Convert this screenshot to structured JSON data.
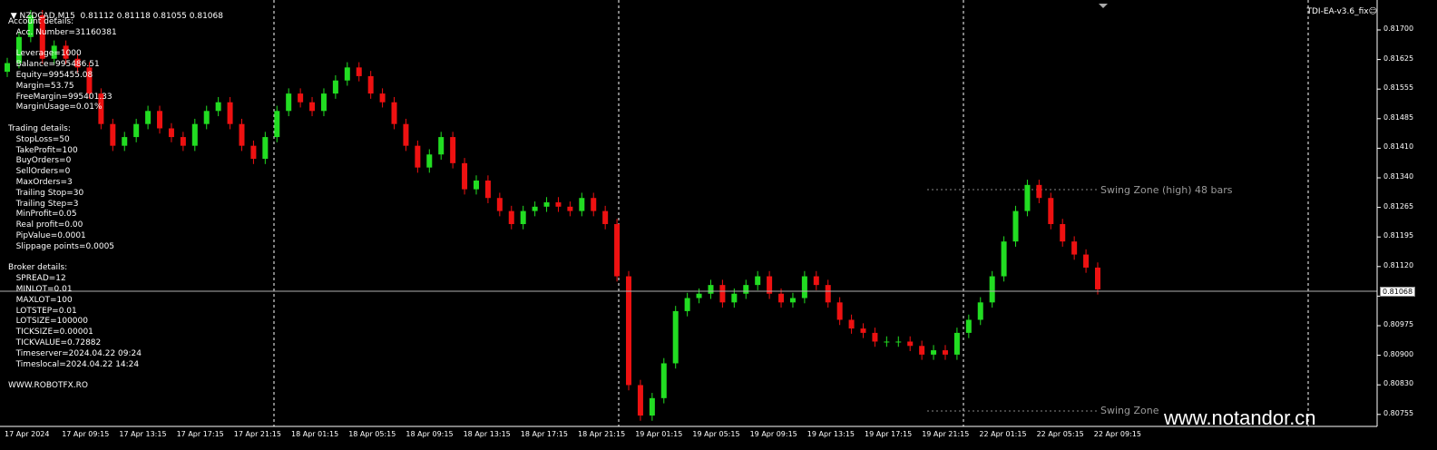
{
  "header": {
    "arrow": "▼",
    "text": "NZDCAD,M15  0.81112 0.81118 0.81055 0.81068"
  },
  "ea_label": "TDI-EA-v3.6_fix☺",
  "watermark": "www.notandor.cn",
  "current_price": "0.81068",
  "info_lines": [
    "Account details:",
    "   Acc. Number=31160381",
    "",
    "   Leverage=1000",
    "   Balance=995486.51",
    "   Equity=995455.08",
    "   Margin=53.75",
    "   FreeMargin=995401.33",
    "   MarginUsage=0.01%",
    "",
    "Trading details:",
    "   StopLoss=50",
    "   TakeProfit=100",
    "   BuyOrders=0",
    "   SellOrders=0",
    "   MaxOrders=3",
    "   Trailing Stop=30",
    "   Trailing Step=3",
    "   MinProfit=0.05",
    "   Real profit=0.00",
    "   PipValue=0.0001",
    "   Slippage points=0.0005",
    "",
    "Broker details:",
    "   SPREAD=12",
    "   MINLOT=0.01",
    "   MAXLOT=100",
    "   LOTSTEP=0.01",
    "   LOTSIZE=100000",
    "   TICKSIZE=0.00001",
    "   TICKVALUE=0.72882",
    "   Timeserver=2024.04.22 09:24",
    "   Timeslocal=2024.04.22 14:24",
    "",
    "WWW.ROBOTFX.RO"
  ],
  "swing": {
    "high_label": "Swing Zone (high) 48 bars",
    "low_label": "Swing Zone"
  },
  "y_ticks": [
    "0.81700",
    "0.81625",
    "0.81555",
    "0.81485",
    "0.81410",
    "0.81340",
    "0.81265",
    "0.81195",
    "0.81120",
    "0.81050",
    "0.80975",
    "0.80900",
    "0.80830",
    "0.80755"
  ],
  "x_ticks": [
    "17 Apr 2024",
    "17 Apr 09:15",
    "17 Apr 13:15",
    "17 Apr 17:15",
    "17 Apr 21:15",
    "18 Apr 01:15",
    "18 Apr 05:15",
    "18 Apr 09:15",
    "18 Apr 13:15",
    "18 Apr 17:15",
    "18 Apr 21:15",
    "19 Apr 01:15",
    "19 Apr 05:15",
    "19 Apr 09:15",
    "19 Apr 13:15",
    "19 Apr 17:15",
    "19 Apr 21:15",
    "22 Apr 01:15",
    "22 Apr 05:15",
    "22 Apr 09:15"
  ],
  "colors": {
    "bull": "#22dd22",
    "bear": "#ee1111",
    "grid": "#ffffff",
    "bg": "#000000"
  },
  "chart_data": {
    "type": "candlestick",
    "symbol": "NZDCAD",
    "timeframe": "M15",
    "close": [
      0.8159,
      0.8165,
      0.817,
      0.816,
      0.8163,
      0.816,
      0.8158,
      0.8152,
      0.8145,
      0.814,
      0.8142,
      0.8145,
      0.8148,
      0.8144,
      0.8142,
      0.814,
      0.8145,
      0.8148,
      0.815,
      0.8145,
      0.814,
      0.8137,
      0.8142,
      0.8148,
      0.8152,
      0.815,
      0.8148,
      0.8152,
      0.8155,
      0.8158,
      0.8156,
      0.8152,
      0.815,
      0.8145,
      0.814,
      0.8135,
      0.8138,
      0.8142,
      0.8136,
      0.813,
      0.8132,
      0.8128,
      0.8125,
      0.8122,
      0.8125,
      0.8126,
      0.8127,
      0.8126,
      0.8125,
      0.8128,
      0.8125,
      0.8122,
      0.811,
      0.8085,
      0.8078,
      0.8082,
      0.809,
      0.8102,
      0.8105,
      0.8106,
      0.8108,
      0.8104,
      0.8106,
      0.8108,
      0.811,
      0.8106,
      0.8104,
      0.8105,
      0.811,
      0.8108,
      0.8104,
      0.81,
      0.8098,
      0.8097,
      0.8095,
      0.8095,
      0.8095,
      0.8094,
      0.8092,
      0.8093,
      0.8092,
      0.8097,
      0.81,
      0.8104,
      0.811,
      0.8118,
      0.8125,
      0.8131,
      0.8128,
      0.8122,
      0.8118,
      0.8115,
      0.8112,
      0.8107
    ],
    "y_min": 0.80755,
    "y_max": 0.81735
  }
}
